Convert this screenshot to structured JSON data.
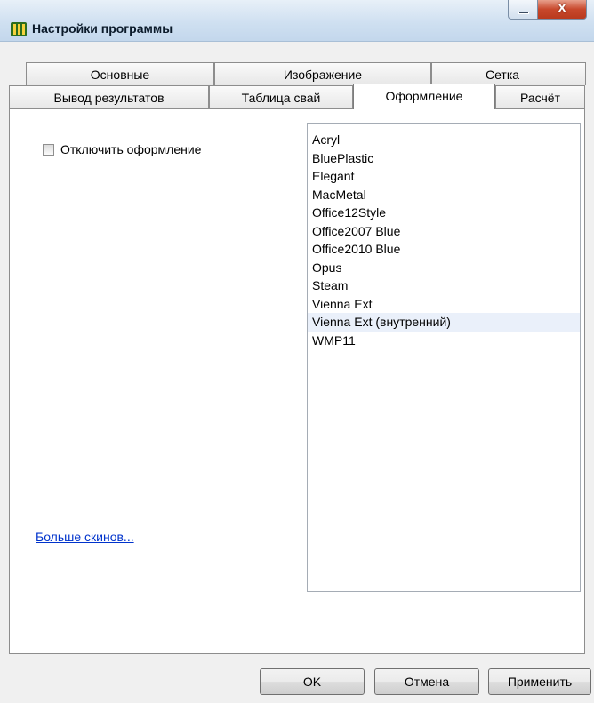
{
  "window": {
    "title": "Настройки программы",
    "close_glyph": "X"
  },
  "tabs": {
    "row1": [
      "Основные",
      "Изображение",
      "Сетка"
    ],
    "row2": [
      "Вывод результатов",
      "Таблица свай",
      "Оформление",
      "Расчёт"
    ],
    "active": "Оформление"
  },
  "appearance": {
    "disable_label": "Отключить оформление",
    "disable_checked": false,
    "skins": [
      "Acryl",
      "BluePlastic",
      "Elegant",
      "MacMetal",
      "Office12Style",
      "Office2007 Blue",
      "Office2010 Blue",
      "Opus",
      "Steam",
      "Vienna Ext",
      "Vienna Ext (внутренний)",
      "WMP11"
    ],
    "selected_skin": "Vienna Ext (внутренний)",
    "more_skins_link": "Больше скинов..."
  },
  "buttons": {
    "ok": "OK",
    "cancel": "Отмена",
    "apply": "Применить"
  },
  "colors": {
    "link": "#0033cc",
    "selected_row": "#eaf0fa",
    "close_button": "#c8482c"
  }
}
